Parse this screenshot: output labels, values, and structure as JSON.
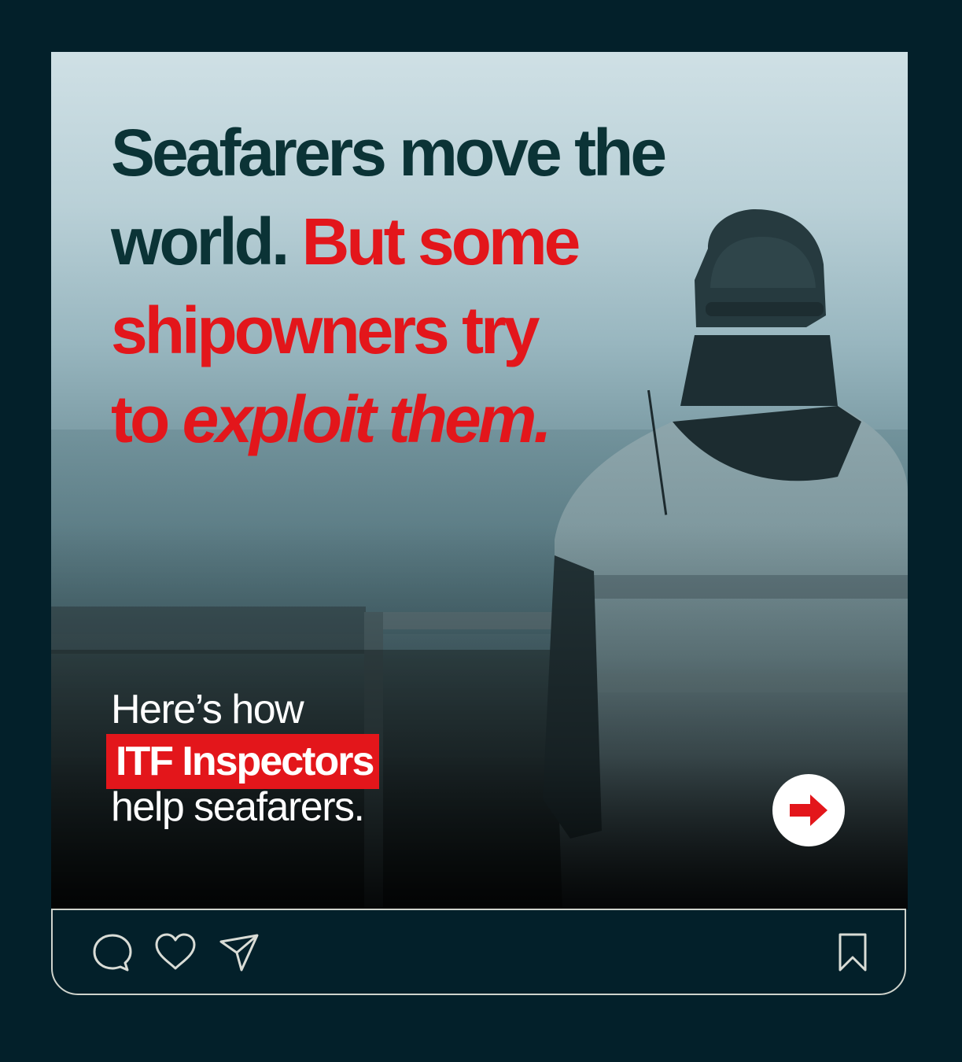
{
  "post": {
    "headline": {
      "line1": "Seafarers move the",
      "line2_dark": "world. ",
      "line2_red": "But some",
      "line3": "shipowners try",
      "line4_plain": "to ",
      "line4_italic": "exploit them."
    },
    "subhead": {
      "line1": "Here’s how",
      "highlight": "ITF Inspectors",
      "line3": "help seafarers."
    },
    "next_icon": "arrow-right-icon"
  },
  "actions": {
    "comment_icon": "comment-icon",
    "like_icon": "heart-icon",
    "share_icon": "send-icon",
    "save_icon": "bookmark-icon"
  },
  "colors": {
    "background": "#03202a",
    "headline_dark": "#0b3336",
    "accent_red": "#e3161b",
    "outline": "#cfd3cc"
  }
}
